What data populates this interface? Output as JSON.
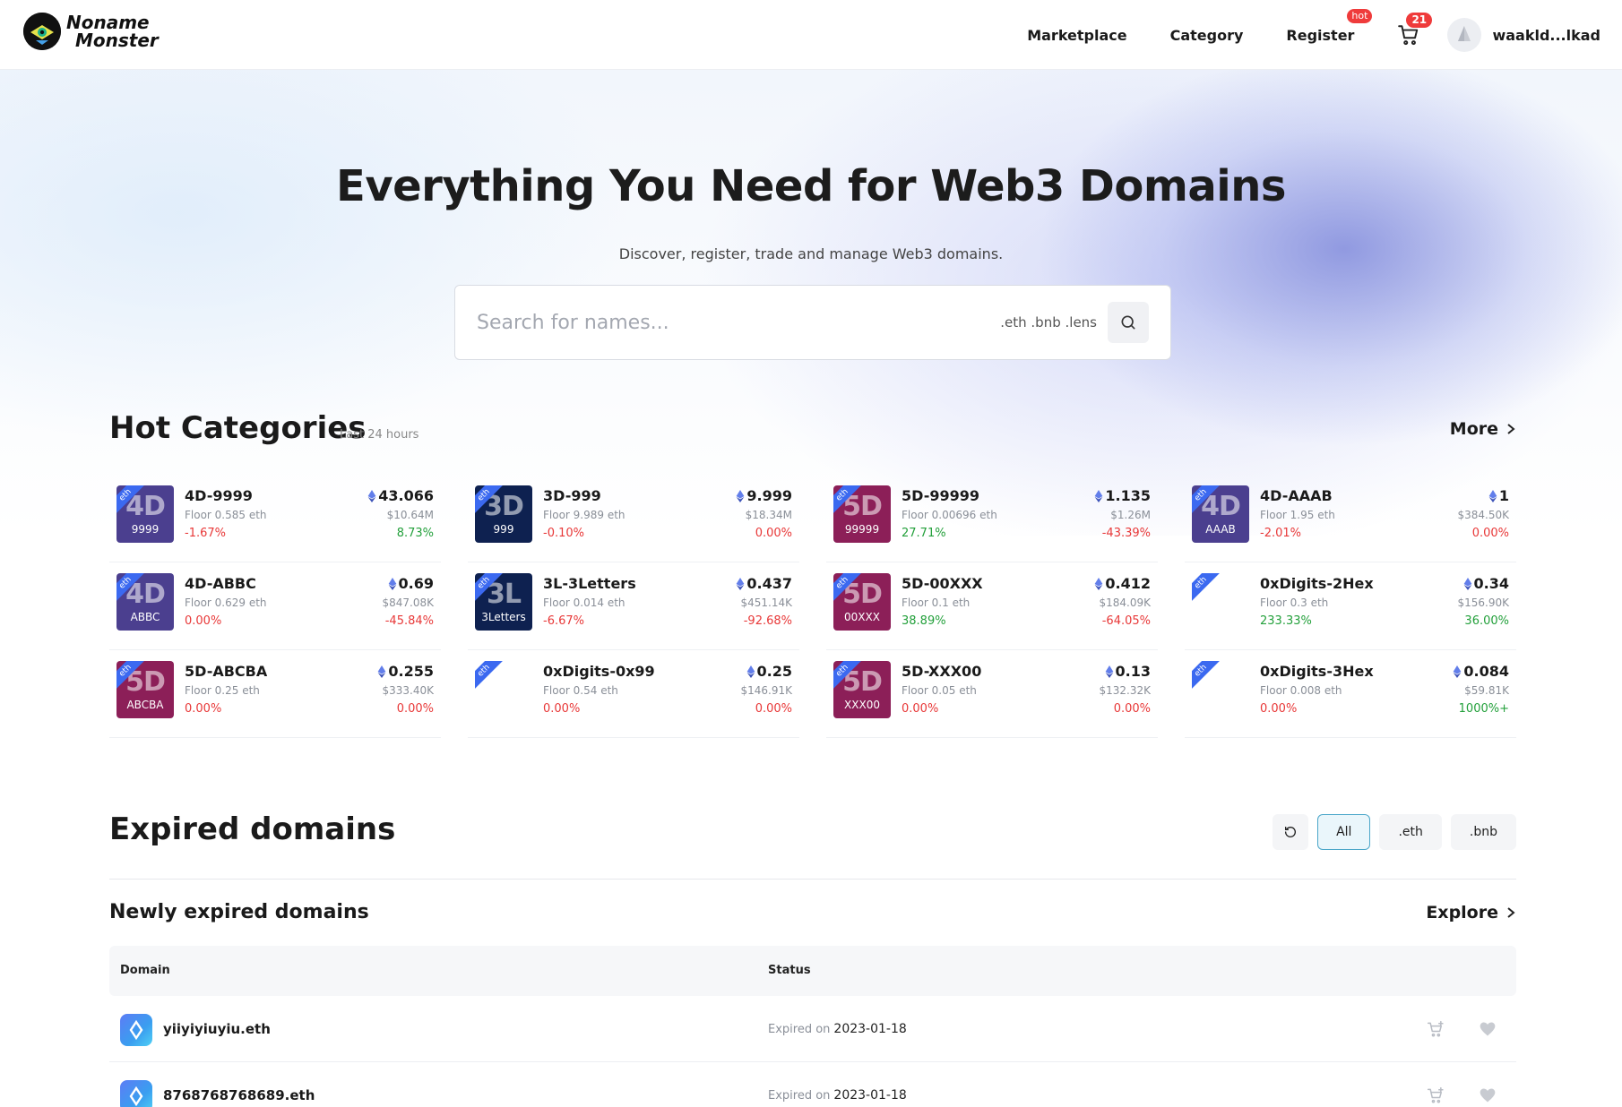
{
  "nav": {
    "logo_line1": "Noname",
    "logo_line2": "Monster",
    "links": [
      "Marketplace",
      "Category",
      "Register"
    ],
    "hot_badge": "hot",
    "cart_count": "21",
    "username": "waakld...lkad"
  },
  "hero": {
    "title": "Everything You Need for Web3 Domains",
    "subtitle": "Discover, register, trade and manage Web3 domains.",
    "search_placeholder": "Search for names...",
    "search_tlds": ".eth .bnb .lens"
  },
  "hot": {
    "title": "Hot Categories",
    "subtitle": "Last 24 hours",
    "more": "More",
    "columns": [
      [
        {
          "name": "4D-9999",
          "floor": "Floor 0.585 eth",
          "chg": "-1.67%",
          "chg_sign": "neg",
          "price": "43.066",
          "usd": "$10.64M",
          "chg2": "8.73%",
          "chg2_sign": "pos",
          "thumb_big": "4D",
          "thumb_small": "9999",
          "thumb_color": "purple"
        },
        {
          "name": "4D-ABBC",
          "floor": "Floor 0.629 eth",
          "chg": "0.00%",
          "chg_sign": "neg",
          "price": "0.69",
          "usd": "$847.08K",
          "chg2": "-45.84%",
          "chg2_sign": "neg",
          "thumb_big": "4D",
          "thumb_small": "ABBC",
          "thumb_color": "purple"
        },
        {
          "name": "5D-ABCBA",
          "floor": "Floor 0.25 eth",
          "chg": "0.00%",
          "chg_sign": "neg",
          "price": "0.255",
          "usd": "$333.40K",
          "chg2": "0.00%",
          "chg2_sign": "neg",
          "thumb_big": "5D",
          "thumb_small": "ABCBA",
          "thumb_color": "magenta"
        }
      ],
      [
        {
          "name": "3D-999",
          "floor": "Floor 9.989 eth",
          "chg": "-0.10%",
          "chg_sign": "neg",
          "price": "9.999",
          "usd": "$18.34M",
          "chg2": "0.00%",
          "chg2_sign": "neg",
          "thumb_big": "3D",
          "thumb_small": "999",
          "thumb_color": "navy"
        },
        {
          "name": "3L-3Letters",
          "floor": "Floor 0.014 eth",
          "chg": "-6.67%",
          "chg_sign": "neg",
          "price": "0.437",
          "usd": "$451.14K",
          "chg2": "-92.68%",
          "chg2_sign": "neg",
          "thumb_big": "3L",
          "thumb_small": "3Letters",
          "thumb_color": "navy"
        },
        {
          "name": "0xDigits-0x99",
          "floor": "Floor 0.54 eth",
          "chg": "0.00%",
          "chg_sign": "neg",
          "price": "0.25",
          "usd": "$146.91K",
          "chg2": "0.00%",
          "chg2_sign": "neg",
          "thumb_big": "",
          "thumb_small": "",
          "thumb_color": "blank"
        }
      ],
      [
        {
          "name": "5D-99999",
          "floor": "Floor 0.00696 eth",
          "chg": "27.71%",
          "chg_sign": "pos",
          "price": "1.135",
          "usd": "$1.26M",
          "chg2": "-43.39%",
          "chg2_sign": "neg",
          "thumb_big": "5D",
          "thumb_small": "99999",
          "thumb_color": "magenta"
        },
        {
          "name": "5D-00XXX",
          "floor": "Floor 0.1 eth",
          "chg": "38.89%",
          "chg_sign": "pos",
          "price": "0.412",
          "usd": "$184.09K",
          "chg2": "-64.05%",
          "chg2_sign": "neg",
          "thumb_big": "5D",
          "thumb_small": "00XXX",
          "thumb_color": "magenta"
        },
        {
          "name": "5D-XXX00",
          "floor": "Floor 0.05 eth",
          "chg": "0.00%",
          "chg_sign": "neg",
          "price": "0.13",
          "usd": "$132.32K",
          "chg2": "0.00%",
          "chg2_sign": "neg",
          "thumb_big": "5D",
          "thumb_small": "XXX00",
          "thumb_color": "magenta"
        }
      ],
      [
        {
          "name": "4D-AAAB",
          "floor": "Floor 1.95 eth",
          "chg": "-2.01%",
          "chg_sign": "neg",
          "price": "1",
          "usd": "$384.50K",
          "chg2": "0.00%",
          "chg2_sign": "neg",
          "thumb_big": "4D",
          "thumb_small": "AAAB",
          "thumb_color": "purple"
        },
        {
          "name": "0xDigits-2Hex",
          "floor": "Floor 0.3 eth",
          "chg": "233.33%",
          "chg_sign": "pos",
          "price": "0.34",
          "usd": "$156.90K",
          "chg2": "36.00%",
          "chg2_sign": "pos",
          "thumb_big": "",
          "thumb_small": "",
          "thumb_color": "blank"
        },
        {
          "name": "0xDigits-3Hex",
          "floor": "Floor 0.008 eth",
          "chg": "0.00%",
          "chg_sign": "neg",
          "price": "0.084",
          "usd": "$59.81K",
          "chg2": "1000%+",
          "chg2_sign": "pos",
          "thumb_big": "",
          "thumb_small": "",
          "thumb_color": "blank"
        }
      ]
    ],
    "ribbon_text": "eth",
    "thumb_colors": {
      "purple": "#4b3f8f",
      "navy": "#0e2150",
      "magenta": "#8c1f58",
      "blank": "transparent"
    }
  },
  "expired": {
    "title": "Expired domains",
    "filters": [
      "All",
      ".eth",
      ".bnb"
    ],
    "active_filter": "All",
    "newly_title": "Newly expired domains",
    "explore": "Explore",
    "columns": [
      "Domain",
      "Status"
    ],
    "status_label": "Expired on",
    "rows": [
      {
        "domain": "yiiyiyiuyiu.eth",
        "date": "2023-01-18"
      },
      {
        "domain": "8768768768689.eth",
        "date": "2023-01-18"
      }
    ]
  },
  "colors": {
    "accent_neg": "#e83838",
    "accent_pos": "#23a03b",
    "badge": "#ef3b3b",
    "eth_blue": "#3b69f0"
  }
}
